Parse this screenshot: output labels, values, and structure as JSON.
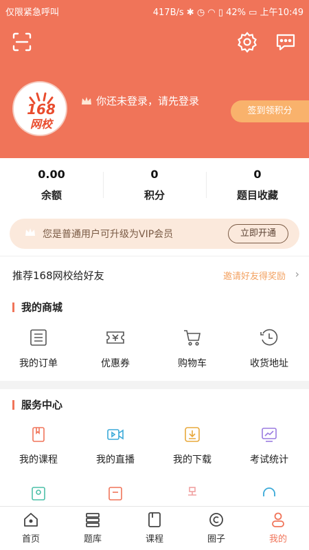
{
  "status_bar": {
    "carrier": "仅限紧急呼叫",
    "speed": "417B/s",
    "battery": "42%",
    "time": "上午10:49"
  },
  "header": {
    "scan_icon": "scan-icon",
    "settings_icon": "gear-icon",
    "message_icon": "message-icon",
    "logo_text_top": "168",
    "logo_text_bottom": "网校",
    "login_prompt": "你还未登录，请先登录",
    "signin_button": "签到领积分",
    "accent": "#f07459"
  },
  "stats": [
    {
      "value": "0.00",
      "label": "余额"
    },
    {
      "value": "0",
      "label": "积分"
    },
    {
      "value": "0",
      "label": "题目收藏"
    }
  ],
  "vip": {
    "text": "您是普通用户可升级为VIP会员",
    "button": "立即开通"
  },
  "recommend": {
    "left": "推荐168网校给好友",
    "right": "邀请好友得奖励"
  },
  "mall": {
    "title": "我的商城",
    "items": [
      {
        "label": "我的订单",
        "icon": "order-list-icon"
      },
      {
        "label": "优惠券",
        "icon": "coupon-icon"
      },
      {
        "label": "购物车",
        "icon": "cart-icon"
      },
      {
        "label": "收货地址",
        "icon": "clock-icon"
      }
    ]
  },
  "service": {
    "title": "服务中心",
    "items": [
      {
        "label": "我的课程",
        "icon": "course-icon"
      },
      {
        "label": "我的直播",
        "icon": "live-icon"
      },
      {
        "label": "我的下载",
        "icon": "download-icon"
      },
      {
        "label": "考试统计",
        "icon": "chart-icon"
      }
    ]
  },
  "tabbar": [
    {
      "label": "首页",
      "icon": "home-icon"
    },
    {
      "label": "题库",
      "icon": "question-bank-icon"
    },
    {
      "label": "课程",
      "icon": "course-book-icon"
    },
    {
      "label": "圈子",
      "icon": "circle-icon"
    },
    {
      "label": "我的",
      "icon": "profile-icon",
      "active": true
    }
  ]
}
